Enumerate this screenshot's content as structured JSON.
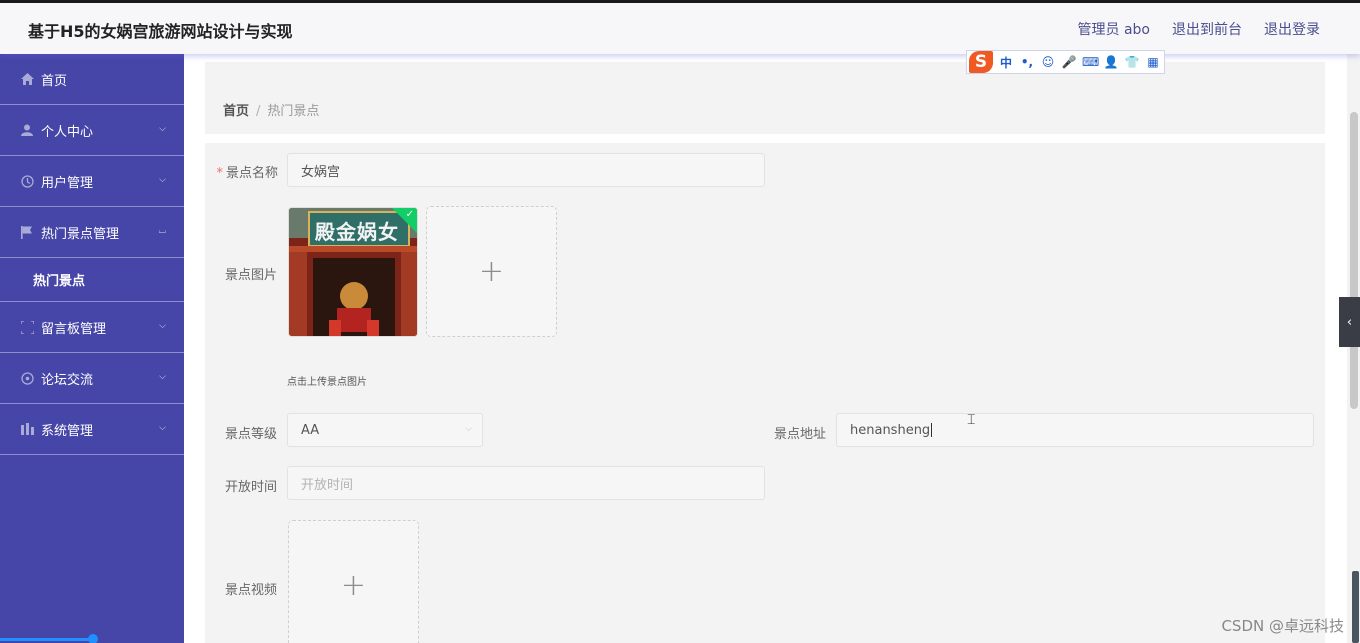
{
  "app": {
    "title": "基于H5的女娲宫旅游网站设计与实现",
    "user": "管理员 abo",
    "to_front": "退出到前台",
    "logout": "退出登录"
  },
  "ime": {
    "logo": "S",
    "items": [
      "中",
      "•,",
      "☺",
      "🎤",
      "⌨",
      "👤",
      "👕",
      "▦"
    ]
  },
  "sidebar": {
    "items": [
      {
        "label": "首页",
        "icon": "home-icon",
        "arrow": ""
      },
      {
        "label": "个人中心",
        "icon": "user-icon",
        "arrow": "down"
      },
      {
        "label": "用户管理",
        "icon": "user-manage-icon",
        "arrow": "down"
      },
      {
        "label": "热门景点管理",
        "icon": "flag-icon",
        "arrow": "up",
        "sub": [
          "热门景点"
        ]
      },
      {
        "label": "留言板管理",
        "icon": "board-icon",
        "arrow": "down"
      },
      {
        "label": "论坛交流",
        "icon": "forum-icon",
        "arrow": "down"
      },
      {
        "label": "系统管理",
        "icon": "system-icon",
        "arrow": "down"
      }
    ]
  },
  "breadcrumb": {
    "home": "首页",
    "sep": "/",
    "current": "热门景点"
  },
  "form": {
    "name_label": "景点名称",
    "name_value": "女娲宫",
    "image_label": "景点图片",
    "image_hint": "点击上传景点图片",
    "image_plaque": "殿金娲女",
    "level_label": "景点等级",
    "level_value": "AA",
    "address_label": "景点地址",
    "address_value": "henansheng",
    "open_label": "开放时间",
    "open_placeholder": "开放时间",
    "video_label": "景点视频",
    "upload_plus": "+"
  },
  "watermark": "CSDN @卓远科技",
  "colors": {
    "sidebar": "#4645a8",
    "topbar": "#f7f7f9",
    "accent": "#4b4e8f",
    "success": "#13ce66"
  }
}
